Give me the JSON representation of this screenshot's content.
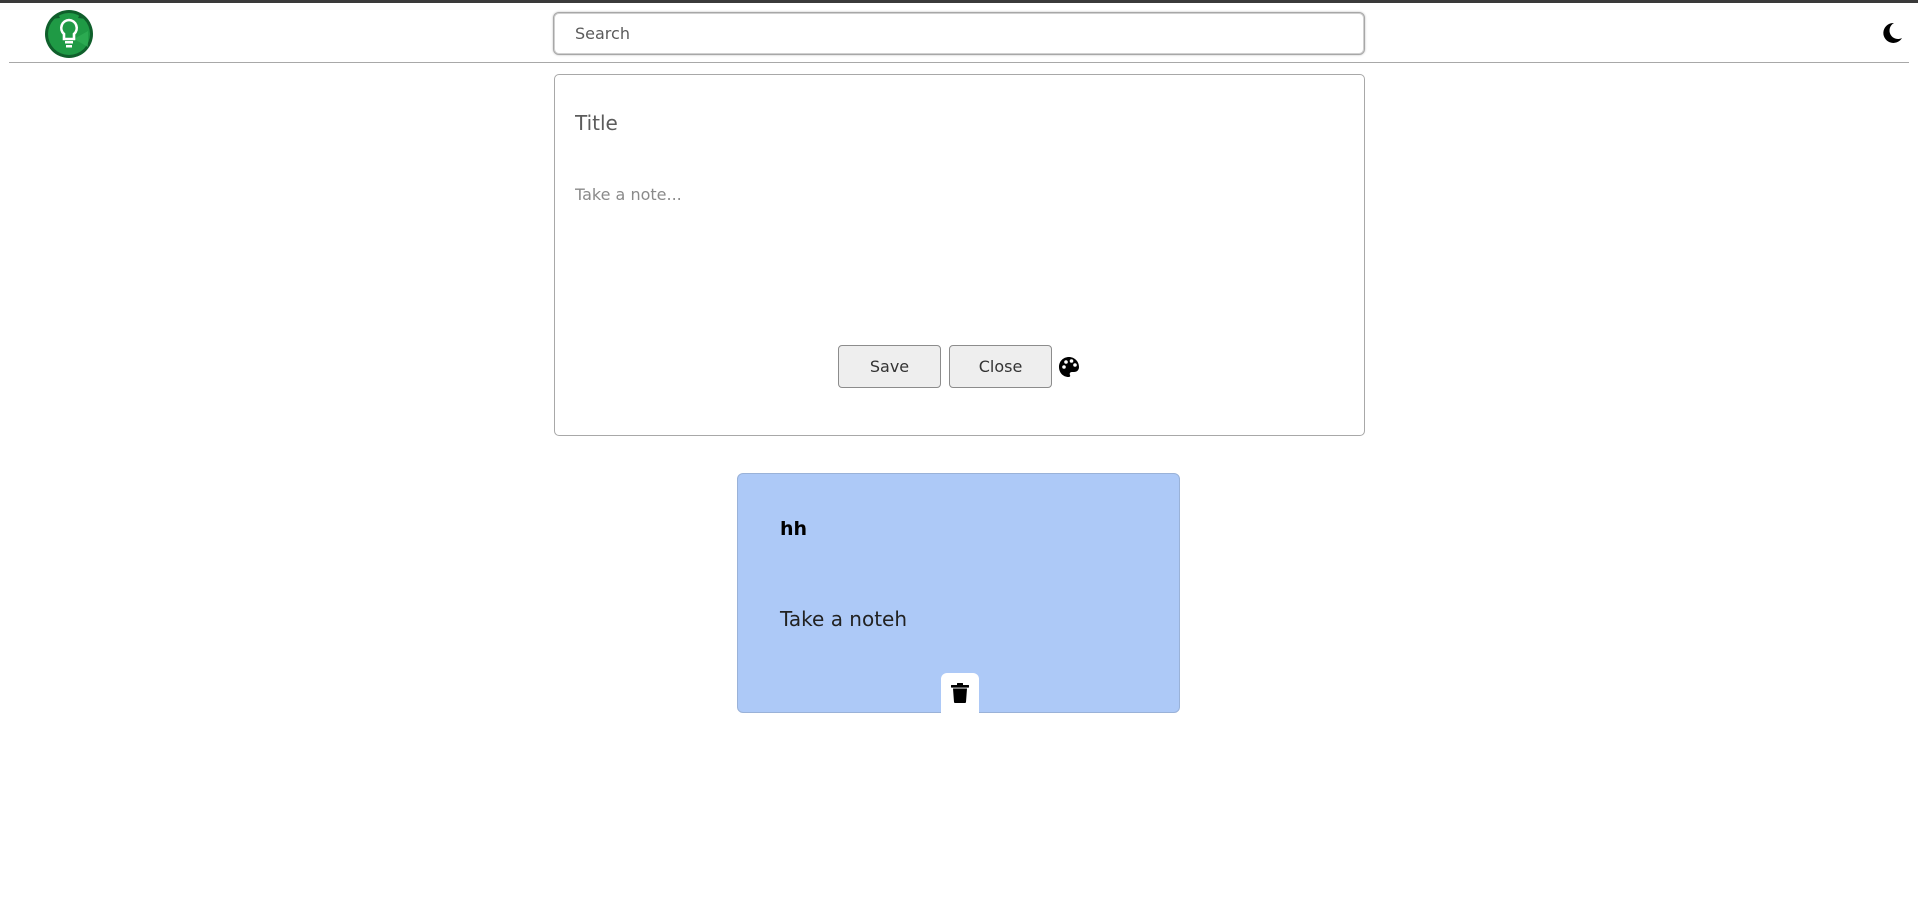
{
  "header": {
    "search": {
      "placeholder": "Search",
      "value": ""
    },
    "logo_icon": "lightbulb-logo",
    "theme_icon": "moon-icon"
  },
  "composer": {
    "title_placeholder": "Title",
    "note_placeholder": "Take a note...",
    "save_label": "Save",
    "close_label": "Close",
    "palette_icon": "palette-icon"
  },
  "notes": [
    {
      "title": "hh",
      "body": "Take a noteh",
      "color": "#adc9f7",
      "delete_icon": "trash-icon"
    }
  ],
  "colors": {
    "logo_green": "#1f8f3a",
    "note_blue": "#adc9f7",
    "button_bg": "#eeeeee"
  }
}
